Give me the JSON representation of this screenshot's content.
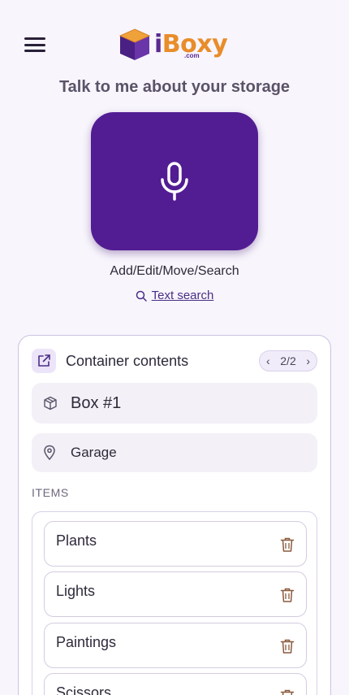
{
  "header": {
    "menu_icon": "hamburger-menu-icon",
    "logo": {
      "letter_i": "i",
      "letters_rest": "Boxy",
      "suffix": ".com"
    }
  },
  "voice": {
    "prompt": "Talk to me about your storage",
    "mic_icon": "microphone-icon",
    "caption": "Add/Edit/Move/Search",
    "text_search_label": "Text search"
  },
  "card": {
    "title": "Container contents",
    "pager": {
      "current": "2/2",
      "prev_icon": "chevron-left-icon",
      "next_icon": "chevron-right-icon"
    },
    "container_name": "Box #1",
    "location": "Garage",
    "items_label": "ITEMS",
    "items": [
      {
        "name": "Plants"
      },
      {
        "name": "Lights"
      },
      {
        "name": "Paintings"
      },
      {
        "name": "Scissors"
      }
    ]
  },
  "colors": {
    "accent": "#521d93",
    "brand_orange": "#e88d2a",
    "background": "#f8f5fc"
  }
}
